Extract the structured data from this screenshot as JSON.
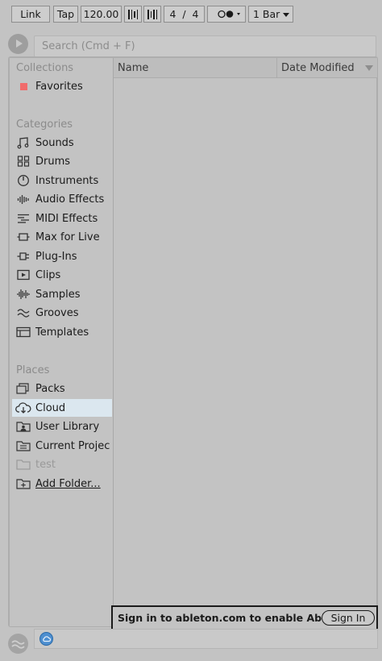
{
  "transport": {
    "link_label": "Link",
    "tap_label": "Tap",
    "tempo": "120.00",
    "time_signature": "4  /  4",
    "quantization": "1 Bar"
  },
  "search": {
    "placeholder": "Search (Cmd + F)"
  },
  "sidebar": {
    "collections": {
      "header": "Collections",
      "items": [
        {
          "label": "Favorites",
          "color": "#f06b6b"
        }
      ]
    },
    "categories": {
      "header": "Categories",
      "items": [
        {
          "label": "Sounds",
          "icon": "note-icon"
        },
        {
          "label": "Drums",
          "icon": "drum-grid-icon"
        },
        {
          "label": "Instruments",
          "icon": "knob-icon"
        },
        {
          "label": "Audio Effects",
          "icon": "audio-bars-icon"
        },
        {
          "label": "MIDI Effects",
          "icon": "midi-lines-icon"
        },
        {
          "label": "Max for Live",
          "icon": "max-device-icon"
        },
        {
          "label": "Plug-Ins",
          "icon": "plug-icon"
        },
        {
          "label": "Clips",
          "icon": "play-box-icon"
        },
        {
          "label": "Samples",
          "icon": "waveform-icon"
        },
        {
          "label": "Grooves",
          "icon": "groove-wave-icon"
        },
        {
          "label": "Templates",
          "icon": "template-icon"
        }
      ]
    },
    "places": {
      "header": "Places",
      "items": [
        {
          "label": "Packs",
          "icon": "packs-icon"
        },
        {
          "label": "Cloud",
          "icon": "cloud-download-icon",
          "selected": true
        },
        {
          "label": "User Library",
          "icon": "user-folder-icon"
        },
        {
          "label": "Current Projec",
          "icon": "project-folder-icon"
        },
        {
          "label": "test",
          "icon": "folder-icon",
          "disabled": true
        },
        {
          "label": "Add Folder...",
          "icon": "add-folder-icon"
        }
      ]
    }
  },
  "content": {
    "columns": [
      "Name",
      "Date Modified"
    ]
  },
  "banner": {
    "message": "Sign in to ableton.com to enable Ablet...",
    "button_label": "Sign In"
  },
  "colors": {
    "background": "#c3c3c3",
    "selected_row": "#dbe7ef",
    "favorite": "#f06b6b",
    "cloud_status": "#4e8fd0"
  }
}
